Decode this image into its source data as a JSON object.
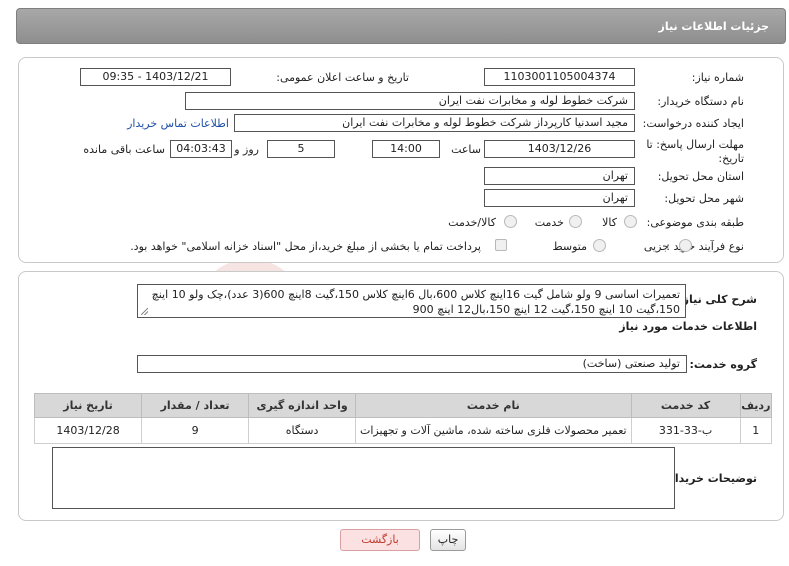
{
  "header": {
    "title": "جزئیات اطلاعات نیاز"
  },
  "form": {
    "need_number_label": "شماره نیاز:",
    "need_number": "1103001105004374",
    "announce_label": "تاریخ و ساعت اعلان عمومی:",
    "announce_value": "1403/12/21 - 09:35",
    "buyer_label": "نام دستگاه خریدار:",
    "buyer_value": "شرکت خطوط لوله و مخابرات نفت ایران",
    "creator_label": "ایجاد کننده درخواست:",
    "creator_value": "مجید اسدنیا  کارپرداز شرکت خطوط لوله و مخابرات نفت ایران",
    "contact_link": "اطلاعات تماس خریدار",
    "deadline_label_1": "مهلت ارسال پاسخ: تا",
    "deadline_label_2": "تاریخ:",
    "deadline_date": "1403/12/26",
    "time_label": "ساعت",
    "deadline_time": "14:00",
    "days_value": "5",
    "days_label": "روز و",
    "remaining_time": "04:03:43",
    "remaining_label": "ساعت باقی مانده",
    "province_label": "استان محل تحویل:",
    "province_value": "تهران",
    "city_label": "شهر محل تحویل:",
    "city_value": "تهران",
    "category_label": "طبقه بندی موضوعی:",
    "category_options": [
      "کالا",
      "خدمت",
      "کالا/خدمت"
    ],
    "process_label": "نوع فرآیند خرید :",
    "process_options": [
      "جزیی",
      "متوسط"
    ],
    "payment_note": "پرداخت تمام یا بخشی از مبلغ خرید،از محل \"اسناد خزانه اسلامی\" خواهد بود."
  },
  "details": {
    "summary_label": "شرح کلی نیاز:",
    "summary_text": "تعمیرات اساسی 9 ولو شامل گیت 16اینچ کلاس 600،بال 6اینچ کلاس 150،گیت 8اینچ 600(3 عدد)،چک ولو 10 اینچ 150،گیت 10 اینچ 150،گیت 12 اینچ 150،بال12 اینچ 900",
    "services_title": "اطلاعات خدمات مورد نیاز",
    "service_group_label": "گروه خدمت:",
    "service_group_value": "تولید صنعتی (ساخت)",
    "table": {
      "headers": [
        "ردیف",
        "کد خدمت",
        "نام خدمت",
        "واحد اندازه گیری",
        "تعداد / مقدار",
        "تاریخ نیاز"
      ],
      "rows": [
        [
          "1",
          "ب-33-331",
          "تعمیر محصولات فلزی ساخته شده، ماشین آلات و تجهیزات",
          "دستگاه",
          "9",
          "1403/12/28"
        ]
      ]
    },
    "buyer_notes_label": "توضیحات خریدار:",
    "buyer_notes_value": ""
  },
  "buttons": {
    "print": "چاپ",
    "back": "بازگشت"
  },
  "colors": {
    "header_bg": "#9a9a9a",
    "link": "#1f4fa8",
    "back_text": "#c0392b",
    "back_bg": "#fbe1e1"
  }
}
